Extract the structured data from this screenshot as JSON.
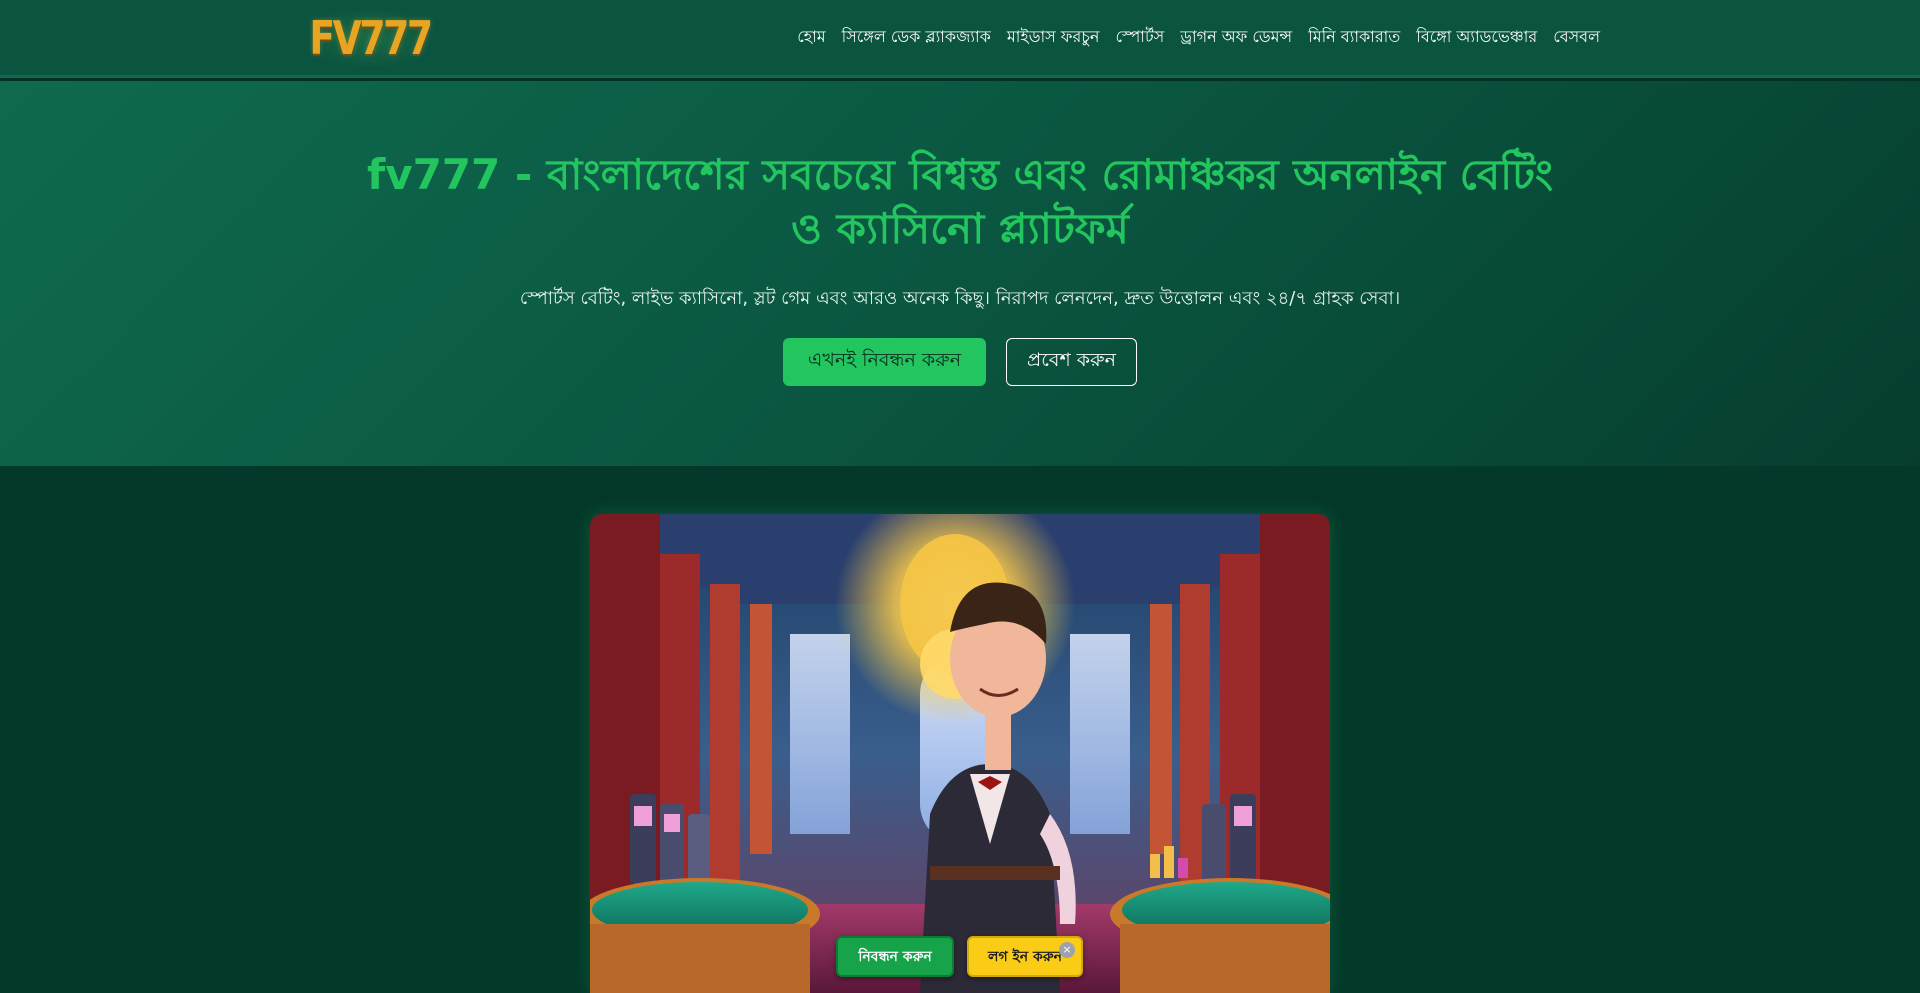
{
  "header": {
    "logo_text": "FV777",
    "nav": [
      {
        "label": "হোম"
      },
      {
        "label": "সিঙ্গেল ডেক ব্ল্যাকজ্যাক"
      },
      {
        "label": "মাইডাস ফরচুন"
      },
      {
        "label": "স্পোর্টস"
      },
      {
        "label": "ড্রাগন অফ ডেমন্স"
      },
      {
        "label": "মিনি ব্যাকারাত"
      },
      {
        "label": "বিঙ্গো অ্যাডভেঞ্চার"
      },
      {
        "label": "বেসবল"
      }
    ]
  },
  "hero": {
    "title_line1": "fv777 - বাংলাদেশের সবচেয়ে বিশ্বস্ত এবং রোমাঞ্চকর অনলাইন বেটিং",
    "title_line2": "ও ক্যাসিনো প্ল্যাটফর্ম",
    "subtitle": "স্পোর্টস বেটিং, লাইভ ক্যাসিনো, স্লট গেম এবং আরও অনেক কিছু। নিরাপদ লেনদেন, দ্রুত উত্তোলন এবং ২৪/৭ গ্রাহক সেবা।",
    "register_label": "এখনই নিবন্ধন করুন",
    "login_label": "প্রবেশ করুন"
  },
  "floating_bar": {
    "register_label": "নিবন্ধন করুন",
    "login_label": "লগ ইন করুন",
    "close_symbol": "×"
  },
  "colors": {
    "header_bg": "#0b5440",
    "page_bg": "#04382a",
    "accent_green": "#22c55e",
    "accent_yellow": "#facc15",
    "logo_gold": "#e6a623"
  }
}
